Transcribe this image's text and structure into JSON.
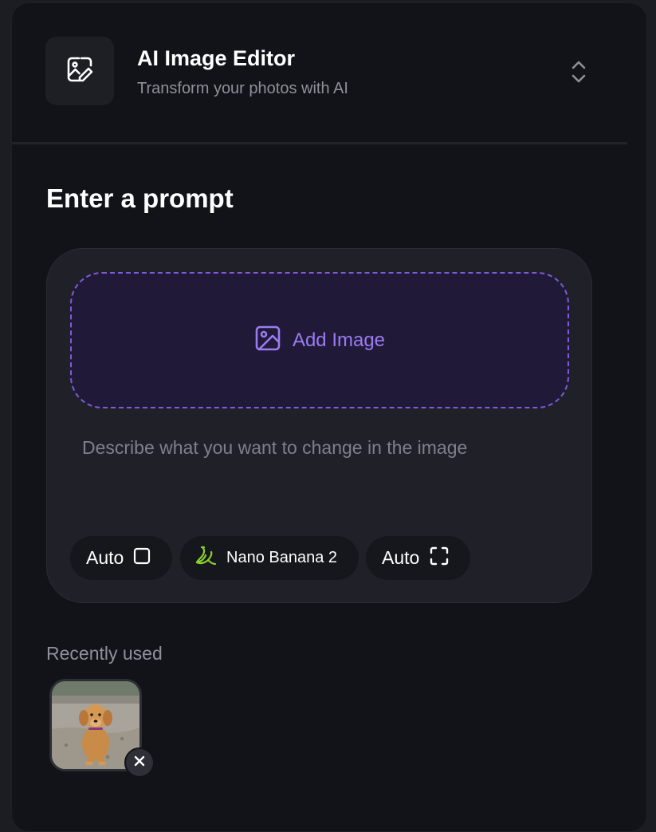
{
  "header": {
    "title": "AI Image Editor",
    "subtitle": "Transform your photos with AI",
    "icon": "image-edit-icon",
    "toggle_icon": "chevron-up-down-icon"
  },
  "prompt_section": {
    "title": "Enter a prompt",
    "add_image_label": "Add Image",
    "add_image_icon": "image-icon",
    "input_placeholder": "Describe what you want to change in the image",
    "input_value": "",
    "chips": {
      "aspect_ratio": {
        "label": "Auto",
        "icon": "square-icon"
      },
      "model": {
        "label": "Nano Banana 2",
        "icon": "banana-icon"
      },
      "size": {
        "label": "Auto",
        "icon": "expand-corners-icon"
      }
    }
  },
  "recent": {
    "label": "Recently used",
    "items": [
      {
        "subject": "golden retriever puppy photo",
        "remove_icon": "close-icon"
      }
    ]
  },
  "colors": {
    "accent": "#9b7bf2",
    "accent_border": "#7c5cd6",
    "banana": "#8bd12f",
    "background": "#121318",
    "card": "#202128"
  }
}
